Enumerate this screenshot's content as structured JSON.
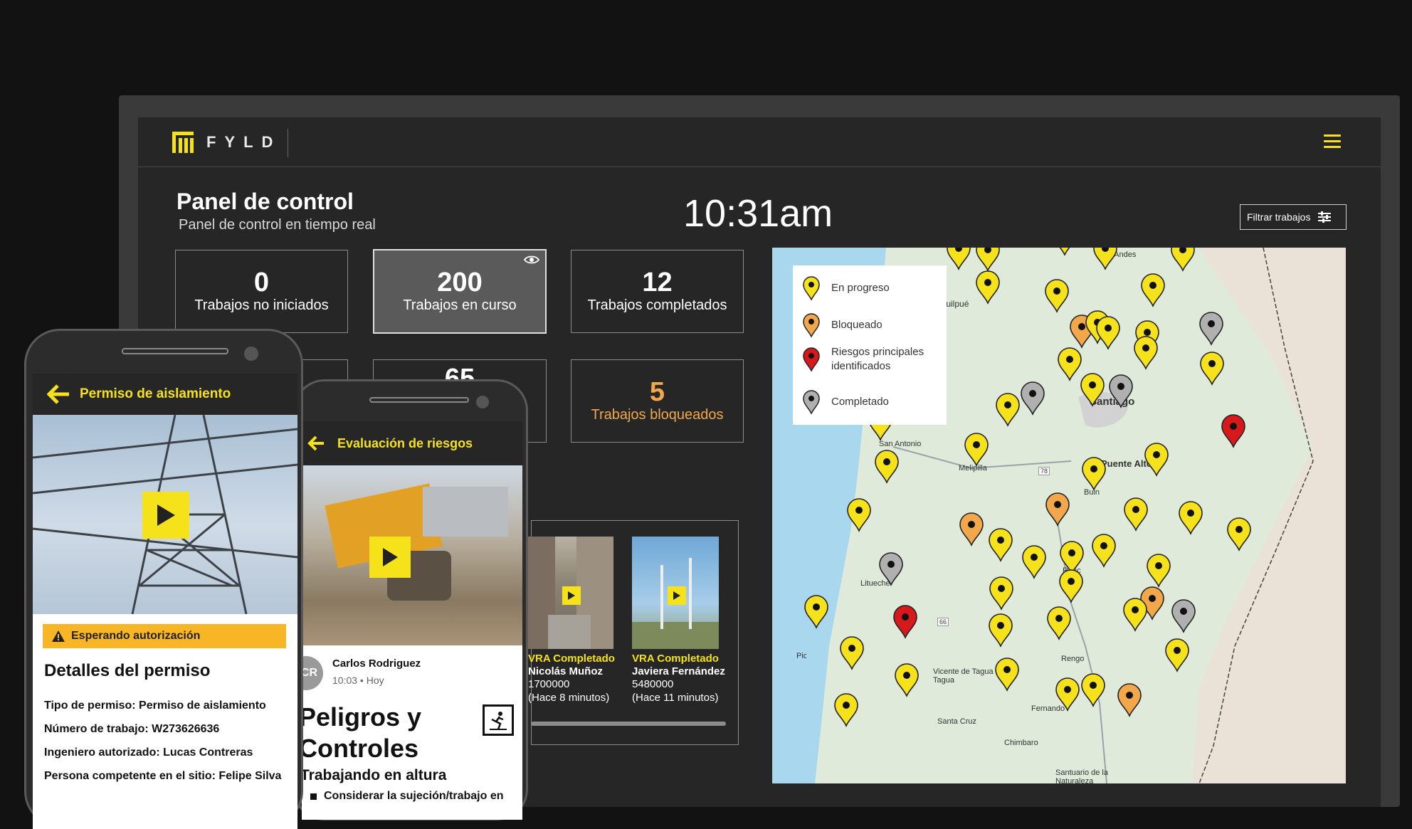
{
  "app": {
    "brand": "FYLD"
  },
  "header": {
    "title": "Panel de control",
    "subtitle": "Panel de control en tiempo real",
    "clock": "10:31am",
    "filter_label": "Filtrar trabajos"
  },
  "stats": [
    {
      "value": "0",
      "label": "Trabajos no iniciados"
    },
    {
      "value": "200",
      "label": "Trabajos en curso"
    },
    {
      "value": "12",
      "label": "Trabajos completados"
    },
    {
      "value": "5",
      "label": "Trabajos bloqueados"
    }
  ],
  "partial_stat_value": "65",
  "legend": {
    "items": [
      {
        "label": "En progreso",
        "color": "#f5e21b"
      },
      {
        "label": "Bloqueado",
        "color": "#f2a84a"
      },
      {
        "label": "Riesgos principales identificados",
        "color": "#d7191c"
      },
      {
        "label": "Completado",
        "color": "#b0b0b0"
      }
    ]
  },
  "map": {
    "places": [
      "Los Andes",
      "Quilpué",
      "Santiago",
      "San Antonio",
      "Melipilla",
      "Puente Alto",
      "Buin",
      "Litueche",
      "Rancagua",
      "Pichilemu",
      "Rengo",
      "Vicente de Tagua Tagua",
      "Santa Cruz",
      "Fernando",
      "Chimbarongo",
      "Santuario de la Naturaleza"
    ],
    "road_labels": [
      "78",
      "66"
    ]
  },
  "vra": [
    {
      "title": "VRA Completado",
      "name": "Nicolás Muñoz",
      "id": "1700000",
      "ago": "(Hace 8 minutos)"
    },
    {
      "title": "VRA Completado",
      "name": "Javiera Fernández",
      "id": "5480000",
      "ago": "(Hace 11 minutos)"
    }
  ],
  "phone1": {
    "title": "Permiso de aislamiento",
    "status": "Esperando autorización",
    "heading": "Detalles del permiso",
    "lines": [
      "Tipo de permiso: Permiso de aislamiento",
      "Número de trabajo: W273626636",
      "Ingeniero autorizado: Lucas Contreras",
      "Persona competente en el sitio: Felipe Silva"
    ]
  },
  "phone2": {
    "title": "Evaluación de riesgos",
    "author_initials": "CR",
    "author": "Carlos Rodriguez",
    "time": "10:03",
    "day": "Hoy",
    "heading_line1": "Peligros y",
    "heading_line2": "Controles",
    "section": "Trabajando en altura",
    "bullet": "Considerar la sujeción/trabajo en"
  },
  "colors": {
    "accent": "#f5e21b",
    "blocked": "#f2a84a",
    "risk": "#d7191c",
    "completed": "#b0b0b0"
  }
}
